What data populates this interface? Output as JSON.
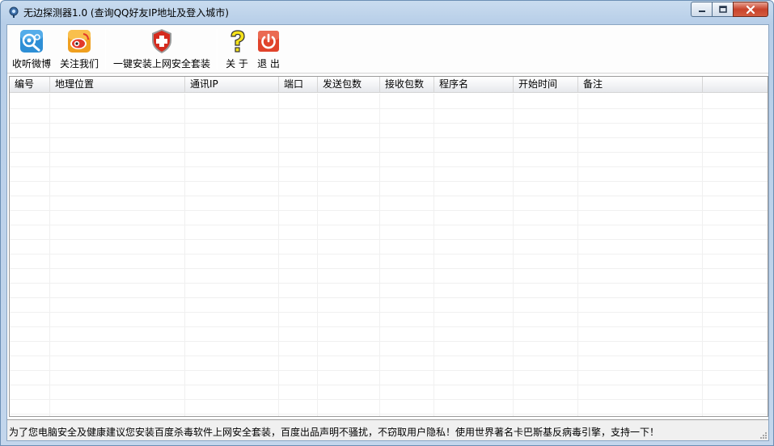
{
  "window": {
    "title": "无边探测器1.0 (查询QQ好友IP地址及登入城市)"
  },
  "toolbar": {
    "items": [
      {
        "label": "收听微博",
        "icon": "weibo-listen-icon"
      },
      {
        "label": "关注我们",
        "icon": "weibo-follow-icon"
      },
      {
        "label": "一键安装上网安全套装",
        "icon": "security-shield-icon"
      },
      {
        "label": "关 于",
        "icon": "help-question-icon"
      },
      {
        "label": "退 出",
        "icon": "power-exit-icon"
      }
    ]
  },
  "table": {
    "columns": [
      "编号",
      "地理位置",
      "通讯IP",
      "端口",
      "发送包数",
      "接收包数",
      "程序名",
      "开始时间",
      "备注"
    ],
    "rows": []
  },
  "status_bar": {
    "text": "为了您电脑安全及健康建议您安装百度杀毒软件上网安全套装，百度出品声明不骚扰，不窃取用户隐私！使用世界著名卡巴斯基反病毒引擎，支持一下！"
  },
  "colors": {
    "title_bar": "#c3d6ec",
    "close_button": "#c8432b",
    "grid_border": "#9a9a9a"
  }
}
